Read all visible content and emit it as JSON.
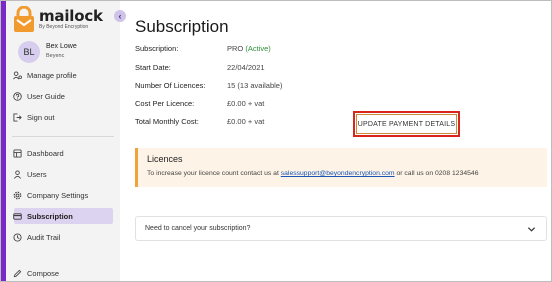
{
  "brand": {
    "name": "mailock",
    "tagline": "By Beyond Encryption"
  },
  "sidebar": {
    "collapse_glyph": "‹",
    "user": {
      "initials": "BL",
      "name": "Bex Lowe",
      "org": "Beyenc"
    },
    "account_items": [
      {
        "label": "Manage profile",
        "icon": "users-gear-icon"
      },
      {
        "label": "User Guide",
        "icon": "help-circle-icon"
      },
      {
        "label": "Sign out",
        "icon": "sign-out-icon"
      }
    ],
    "nav_items": [
      {
        "label": "Dashboard",
        "icon": "dashboard-icon"
      },
      {
        "label": "Users",
        "icon": "user-icon"
      },
      {
        "label": "Company Settings",
        "icon": "gear-icon"
      },
      {
        "label": "Subscription",
        "icon": "credit-card-icon",
        "active": true
      },
      {
        "label": "Audit Trail",
        "icon": "history-icon"
      },
      {
        "label": "Compose",
        "icon": "pencil-icon"
      }
    ]
  },
  "main": {
    "title": "Subscription",
    "details": [
      {
        "label": "Subscription:",
        "value": "PRO",
        "tag": "(Active)"
      },
      {
        "label": "Start Date:",
        "value": "22/04/2021"
      },
      {
        "label": "Number Of Licences:",
        "value": "15 (13 available)"
      },
      {
        "label": "Cost Per Licence:",
        "value": "£0.00 + vat"
      },
      {
        "label": "Total Monthly Cost:",
        "value": "£0.00 + vat"
      }
    ],
    "update_payment_label": "UPDATE PAYMENT DETAILS",
    "licences_banner": {
      "title": "Licences",
      "text_before": "To increase your licence count contact us at ",
      "email": "salessupport@beyondencryption.com",
      "text_after": " or call us on 0208 1234546"
    },
    "cancel_question": "Need to cancel your subscription?"
  },
  "colors": {
    "accent_purple": "#7b28c9",
    "active_nav_bg": "#dcd3f0",
    "banner_bg": "#fdf3e6",
    "banner_border": "#f1a33b",
    "highlight_red": "#d9261c",
    "active_green": "#2e8f3a",
    "link_blue": "#1a55b6"
  }
}
